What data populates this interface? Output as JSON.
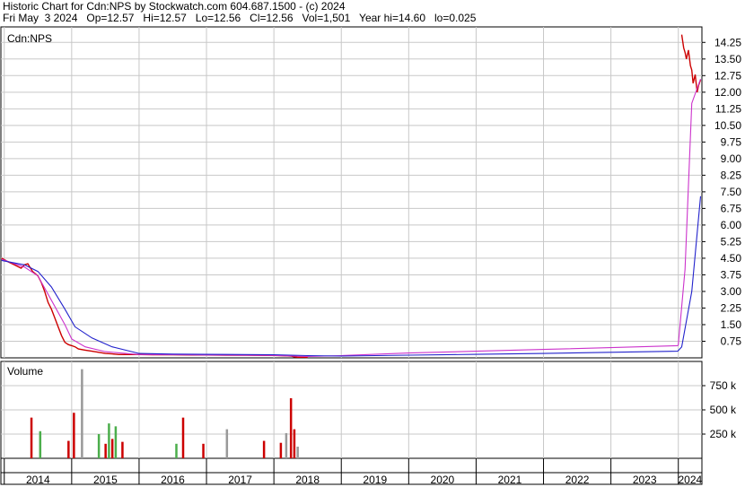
{
  "header": {
    "line1": "Historic Chart for Cdn:NPS by Stockwatch.com 604.687.1500 - (c) 2024",
    "line2": "Fri May  3 2024   Op=12.57   Hi=12.57   Lo=12.56   Cl=12.56   Vol=1,501   Year hi=14.60   lo=0.025"
  },
  "chart_data": [
    {
      "type": "line",
      "title": "Cdn:NPS",
      "y_ticks": [
        "14.25",
        "13.50",
        "12.75",
        "12.00",
        "11.25",
        "10.50",
        "9.75",
        "9.00",
        "8.25",
        "7.50",
        "6.75",
        "6.00",
        "5.25",
        "4.50",
        "3.75",
        "3.00",
        "2.25",
        "1.50",
        "0.75"
      ],
      "ylim": [
        0,
        14.95
      ],
      "x_ticks": [
        "2014",
        "2015",
        "2016",
        "2017",
        "2018",
        "2019",
        "2020",
        "2021",
        "2022",
        "2023",
        "2024"
      ],
      "xlim": [
        2013.95,
        2024.35
      ],
      "series": [
        {
          "role": "price",
          "color": "#cc0000",
          "x": [
            2013.96,
            2014.05,
            2014.15,
            2014.25,
            2014.3,
            2014.35,
            2014.42,
            2014.5,
            2014.55,
            2014.6,
            2014.65,
            2014.7,
            2014.75,
            2014.8,
            2014.85,
            2014.9,
            2014.95,
            2015.0,
            2015.05,
            2015.1,
            2015.2,
            2015.3,
            2015.4,
            2015.5,
            2015.6,
            2015.7,
            2015.8,
            2015.9,
            2016.0,
            2016.2,
            2016.5,
            2016.8,
            2017.0,
            2017.3,
            2017.6,
            2017.9,
            2018.0,
            2018.1,
            2018.2,
            2018.25,
            2018.3,
            2018.35,
            2018.4,
            2018.45,
            2018.5
          ],
          "y": [
            4.5,
            4.35,
            4.2,
            4.05,
            4.2,
            4.25,
            3.9,
            3.7,
            3.4,
            3.0,
            2.5,
            2.2,
            1.8,
            1.4,
            1.0,
            0.7,
            0.6,
            0.55,
            0.5,
            0.4,
            0.35,
            0.3,
            0.25,
            0.2,
            0.18,
            0.15,
            0.15,
            0.15,
            0.15,
            0.14,
            0.14,
            0.13,
            0.13,
            0.12,
            0.12,
            0.11,
            0.11,
            0.1,
            0.09,
            0.08,
            0.05,
            0.03,
            0.03,
            0.03,
            0.025
          ]
        },
        {
          "role": "price",
          "color": "#cc0000",
          "x": [
            2024.05,
            2024.08,
            2024.1,
            2024.12,
            2024.15,
            2024.18,
            2024.2,
            2024.22,
            2024.25,
            2024.28,
            2024.3,
            2024.33
          ],
          "y": [
            14.6,
            14.0,
            13.8,
            13.5,
            13.9,
            13.2,
            13.0,
            12.4,
            12.8,
            12.0,
            12.3,
            12.56
          ]
        },
        {
          "role": "short moving average",
          "color": "#cc33cc",
          "x": [
            2013.96,
            2014.3,
            2014.5,
            2014.7,
            2014.9,
            2015.0,
            2015.2,
            2015.5,
            2016.0,
            2016.5,
            2017.0,
            2018.0,
            2018.5,
            2019.0,
            2020.0,
            2021.0,
            2022.0,
            2023.0,
            2023.99,
            2024.0,
            2024.1,
            2024.2,
            2024.33
          ],
          "y": [
            4.45,
            4.1,
            3.7,
            2.6,
            1.5,
            0.85,
            0.5,
            0.28,
            0.15,
            0.14,
            0.13,
            0.11,
            0.06,
            0.1,
            0.22,
            0.3,
            0.38,
            0.46,
            0.55,
            0.6,
            4.0,
            11.5,
            12.6
          ]
        },
        {
          "role": "long moving average",
          "color": "#2222cc",
          "x": [
            2013.96,
            2014.3,
            2014.5,
            2014.7,
            2014.9,
            2015.05,
            2015.3,
            2015.6,
            2016.0,
            2016.5,
            2017.0,
            2018.0,
            2018.5,
            2019.0,
            2020.0,
            2021.0,
            2022.0,
            2023.0,
            2023.99,
            2024.05,
            2024.2,
            2024.33
          ],
          "y": [
            4.4,
            4.2,
            3.9,
            3.2,
            2.2,
            1.4,
            0.9,
            0.5,
            0.2,
            0.17,
            0.16,
            0.14,
            0.1,
            0.08,
            0.12,
            0.16,
            0.2,
            0.25,
            0.3,
            0.5,
            3.0,
            7.3
          ]
        }
      ]
    },
    {
      "type": "bar",
      "title": "Volume",
      "y_ticks": [
        "750 k",
        "500 k",
        "250 k"
      ],
      "ylim": [
        0,
        1000000
      ],
      "x": [
        2014.4,
        2014.53,
        2014.95,
        2015.03,
        2015.15,
        2015.4,
        2015.5,
        2015.55,
        2015.6,
        2015.65,
        2015.75,
        2016.55,
        2016.65,
        2016.95,
        2017.3,
        2017.85,
        2018.1,
        2018.18,
        2018.25,
        2018.3,
        2018.35
      ],
      "values": [
        420000,
        280000,
        180000,
        470000,
        920000,
        250000,
        150000,
        360000,
        200000,
        330000,
        170000,
        150000,
        420000,
        150000,
        300000,
        180000,
        160000,
        260000,
        620000,
        300000,
        120000
      ],
      "colors": [
        "#cc0000",
        "#4cae4c",
        "#cc0000",
        "#cc0000",
        "#999999",
        "#4cae4c",
        "#cc0000",
        "#4cae4c",
        "#cc0000",
        "#4cae4c",
        "#cc0000",
        "#4cae4c",
        "#cc0000",
        "#cc0000",
        "#999999",
        "#cc0000",
        "#cc0000",
        "#999999",
        "#cc0000",
        "#cc0000",
        "#999999"
      ]
    }
  ]
}
